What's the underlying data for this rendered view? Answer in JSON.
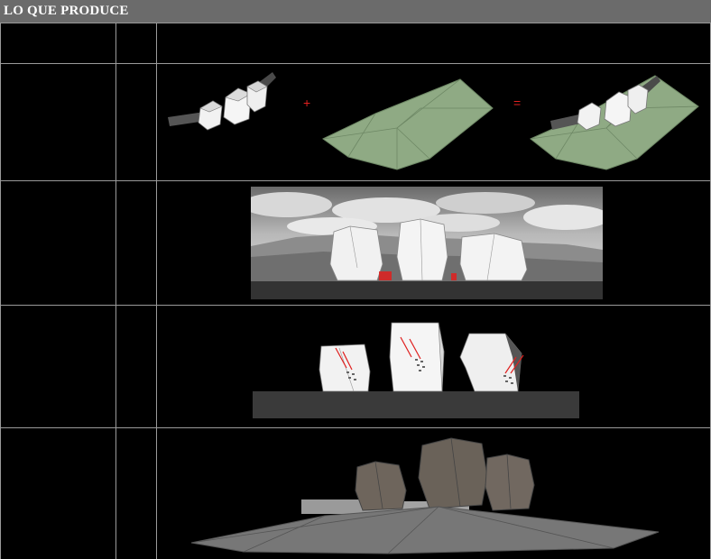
{
  "header": {
    "title": "LO QUE PRODUCE"
  },
  "row2": {
    "plus": "+",
    "equals": "="
  },
  "colors": {
    "accent": "#e0201f",
    "terrain": "#8faa84",
    "header_bg": "#6b6b6b",
    "grid_line": "#9a9a9a"
  }
}
